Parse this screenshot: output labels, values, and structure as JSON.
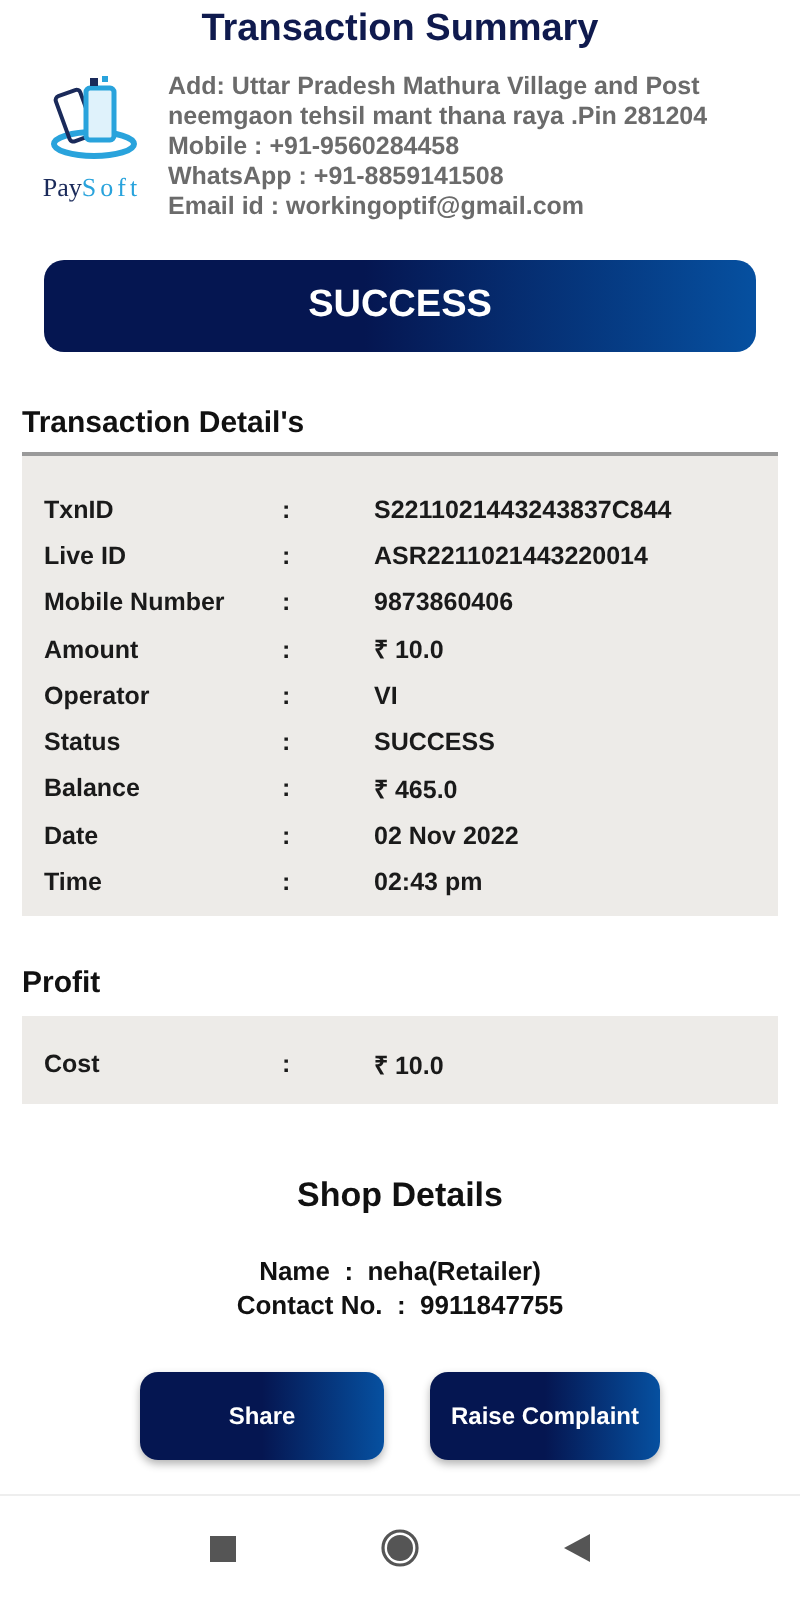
{
  "title": "Transaction Summary",
  "brand": {
    "part_a": "Pay",
    "part_b": "Soft"
  },
  "address_lines": [
    "Add: Uttar Pradesh Mathura Village and Post",
    "neemgaon tehsil mant thana raya .Pin 281204",
    "Mobile : +91-9560284458",
    "WhatsApp : +91-8859141508",
    "Email id : workingoptif@gmail.com"
  ],
  "status_banner": "SUCCESS",
  "details": {
    "heading": "Transaction Detail's",
    "rows": [
      {
        "label": "TxnID",
        "sep": ":",
        "value": "S2211021443243837C844"
      },
      {
        "label": "Live ID",
        "sep": ":",
        "value": "ASR2211021443220014"
      },
      {
        "label": "Mobile Number",
        "sep": ":",
        "value": "9873860406"
      },
      {
        "label": "Amount",
        "sep": ":",
        "value": "₹ 10.0"
      },
      {
        "label": "Operator",
        "sep": ":",
        "value": "VI"
      },
      {
        "label": "Status",
        "sep": ":",
        "value": "SUCCESS"
      },
      {
        "label": "Balance",
        "sep": ":",
        "value": "₹ 465.0"
      },
      {
        "label": "Date",
        "sep": ":",
        "value": "02 Nov 2022"
      },
      {
        "label": "Time",
        "sep": ":",
        "value": "02:43 pm"
      }
    ]
  },
  "profit": {
    "heading": "Profit",
    "rows": [
      {
        "label": "Cost",
        "sep": ":",
        "value": "₹ 10.0"
      }
    ]
  },
  "shop": {
    "heading": "Shop Details",
    "lines": [
      "Name  :  neha(Retailer)",
      "Contact No.  :  9911847755"
    ]
  },
  "buttons": [
    "Share",
    "Raise Complaint"
  ]
}
